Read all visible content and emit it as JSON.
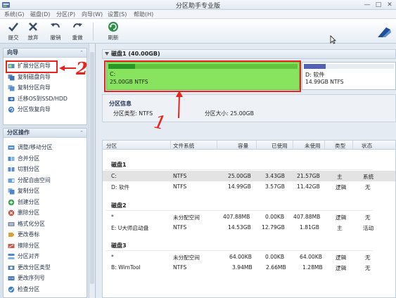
{
  "window": {
    "title": "分区助手专业版",
    "controls": [
      "—",
      "□",
      "✕"
    ]
  },
  "menu": {
    "items": [
      "系统(G)",
      "磁盘(D)",
      "分区(P)",
      "向导(W)",
      "设置(S)",
      "帮助(H)"
    ]
  },
  "toolbar": {
    "buttons": [
      {
        "label": "提交",
        "icon": "commit-icon"
      },
      {
        "label": "放弃",
        "icon": "discard-icon"
      },
      {
        "label": "撤销",
        "icon": "undo-icon"
      },
      {
        "label": "重做",
        "icon": "redo-icon"
      },
      {
        "label": "刷新",
        "icon": "refresh-icon"
      }
    ]
  },
  "sidebar": {
    "wizard": {
      "title": "向导",
      "collapse": "⌃",
      "items": [
        {
          "label": "扩展分区向导",
          "icon": "extend-partition-icon"
        },
        {
          "label": "复制磁盘向导",
          "icon": "copy-disk-icon"
        },
        {
          "label": "复制分区向导",
          "icon": "copy-partition-icon"
        },
        {
          "label": "迁移OS到SSD/HDD",
          "icon": "migrate-os-icon"
        },
        {
          "label": "分区恢复向导",
          "icon": "partition-recovery-icon"
        }
      ]
    },
    "operations": {
      "title": "分区操作",
      "collapse": "⌃",
      "items": [
        {
          "label": "调整/移动分区",
          "icon": "resize-move-icon"
        },
        {
          "label": "合并分区",
          "icon": "merge-icon"
        },
        {
          "label": "切割分区",
          "icon": "split-icon"
        },
        {
          "label": "分配自由空间",
          "icon": "allocate-space-icon"
        },
        {
          "label": "复制分区",
          "icon": "copy-icon"
        },
        {
          "label": "创建分区",
          "icon": "create-icon"
        },
        {
          "label": "删除分区",
          "icon": "delete-icon"
        },
        {
          "label": "格式化分区",
          "icon": "format-icon"
        },
        {
          "label": "更改卷标",
          "icon": "label-icon"
        },
        {
          "label": "擦除分区",
          "icon": "wipe-icon"
        },
        {
          "label": "分区对齐",
          "icon": "align-icon"
        },
        {
          "label": "更改分区类型",
          "icon": "change-type-icon"
        },
        {
          "label": "更改序列号",
          "icon": "serial-icon"
        },
        {
          "label": "检查分区",
          "icon": "check-icon"
        }
      ]
    }
  },
  "disk_map": {
    "header": "磁盘1 (40.00GB)",
    "partitions": [
      {
        "name": "C:",
        "info": "25.00GB NTFS",
        "used_fraction": 0.14
      },
      {
        "name": "D: 软件",
        "info": "14.99GB NTFS",
        "used_fraction": 0.24
      }
    ]
  },
  "partition_info": {
    "title": "分区信息",
    "type_line": "分区类型: NTFS",
    "size_line": "分区大小: 25.00GB"
  },
  "table": {
    "columns": [
      "分区",
      "文件系统",
      "容量",
      "已使用",
      "未使用",
      "类型",
      "状态"
    ],
    "disks": [
      {
        "label": "磁盘1",
        "rows": [
          {
            "cells": [
              "C:",
              "NTFS",
              "25.00GB",
              "3.43GB",
              "21.57GB",
              "主",
              "系统"
            ],
            "selected": true
          },
          {
            "cells": [
              "D: 软件",
              "NTFS",
              "14.99GB",
              "3.57GB",
              "11.42GB",
              "逻辑",
              "无"
            ],
            "selected": false
          }
        ]
      },
      {
        "label": "磁盘2",
        "rows": [
          {
            "cells": [
              "*",
              "未分配空间",
              "407.88MB",
              "0.00KB",
              "407.88MB",
              "逻辑",
              "无"
            ],
            "selected": false
          },
          {
            "cells": [
              "E: U大师启动盘",
              "NTFS",
              "14.53GB",
              "12.79GB",
              "1.81GB",
              "主",
              "活动"
            ],
            "selected": false
          }
        ]
      },
      {
        "label": "磁盘3",
        "rows": [
          {
            "cells": [
              "*",
              "未分配空间",
              "64.00KB",
              "0.00KB",
              "64.00KB",
              "逻辑",
              "无"
            ],
            "selected": false
          },
          {
            "cells": [
              "B: WimTool",
              "NTFS",
              "3.94MB",
              "2.66MB",
              "1.28MB",
              "逻辑",
              "无"
            ],
            "selected": false
          }
        ]
      }
    ]
  },
  "annotations": {
    "marker_1": "1",
    "marker_2": "2",
    "color": "#e8231e"
  }
}
